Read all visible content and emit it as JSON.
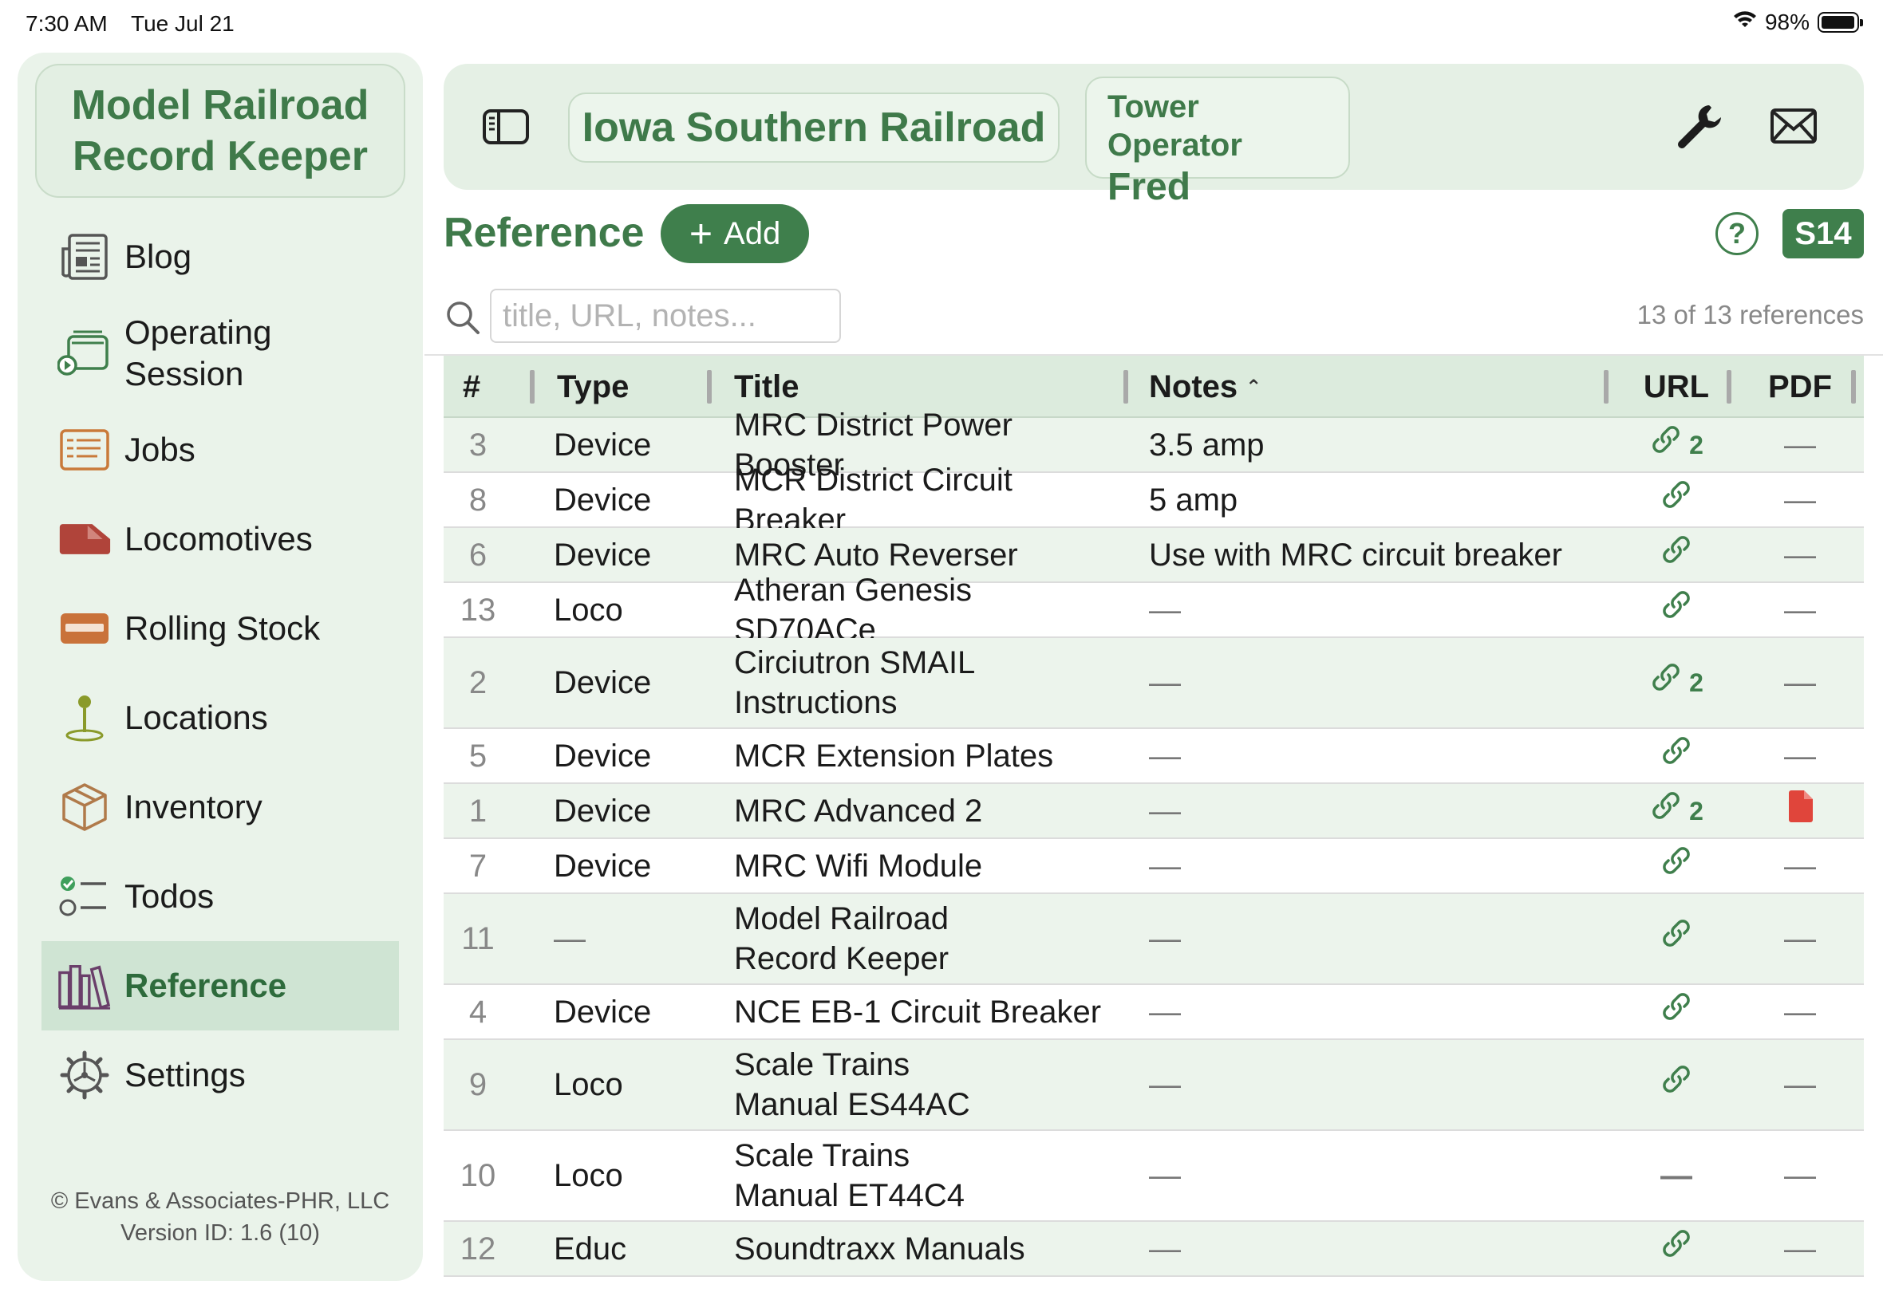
{
  "status_bar": {
    "time": "7:30 AM",
    "date": "Tue Jul 21",
    "battery": "98%",
    "battery_level": 0.98
  },
  "sidebar": {
    "app_title": "Model Railroad\nRecord Keeper",
    "items": [
      {
        "label": "Blog",
        "icon": "newspaper-icon"
      },
      {
        "label": "Operating\nSession",
        "icon": "operating-session-icon"
      },
      {
        "label": "Jobs",
        "icon": "jobs-list-icon"
      },
      {
        "label": "Locomotives",
        "icon": "locomotive-icon"
      },
      {
        "label": "Rolling Stock",
        "icon": "rolling-stock-icon"
      },
      {
        "label": "Locations",
        "icon": "location-pin-icon"
      },
      {
        "label": "Inventory",
        "icon": "box-icon"
      },
      {
        "label": "Todos",
        "icon": "checklist-icon"
      },
      {
        "label": "Reference",
        "icon": "books-icon",
        "active": true
      },
      {
        "label": "Settings",
        "icon": "gear-icon"
      }
    ],
    "copyright": "© Evans & Associates-PHR, LLC",
    "version": "Version ID: 1.6 (10)"
  },
  "header": {
    "railroad": "Iowa Southern Railroad",
    "operator_role": "Tower Operator",
    "operator_name": "Fred"
  },
  "page": {
    "title": "Reference",
    "add_label": "Add",
    "help_label": "?",
    "badge": "S14",
    "search_placeholder": "title, URL, notes...",
    "count_text": "13 of 13 references"
  },
  "table": {
    "columns": {
      "num": "#",
      "type": "Type",
      "title": "Title",
      "notes": "Notes",
      "url": "URL",
      "pdf": "PDF"
    },
    "sort": {
      "column": "Notes",
      "direction": "ascending"
    },
    "rows": [
      {
        "num": "3",
        "type": "Device",
        "title": "MRC District Power Booster",
        "notes": "3.5 amp",
        "url": "link",
        "url_count": "2",
        "pdf": "—"
      },
      {
        "num": "8",
        "type": "Device",
        "title": "MCR District Circuit Breaker",
        "notes": "5 amp",
        "url": "link",
        "url_count": "",
        "pdf": "—"
      },
      {
        "num": "6",
        "type": "Device",
        "title": "MRC Auto Reverser",
        "notes": "Use with MRC circuit breaker",
        "url": "link",
        "url_count": "",
        "pdf": "—"
      },
      {
        "num": "13",
        "type": "Loco",
        "title": "Atheran Genesis SD70ACe",
        "notes": "—",
        "url": "link",
        "url_count": "",
        "pdf": "—"
      },
      {
        "num": "2",
        "type": "Device",
        "title": "Circiutron SMAIL\nInstructions",
        "notes": "—",
        "url": "link",
        "url_count": "2",
        "pdf": "—"
      },
      {
        "num": "5",
        "type": "Device",
        "title": "MCR Extension Plates",
        "notes": "—",
        "url": "link",
        "url_count": "",
        "pdf": "—"
      },
      {
        "num": "1",
        "type": "Device",
        "title": "MRC Advanced 2",
        "notes": "—",
        "url": "link",
        "url_count": "2",
        "pdf": "file"
      },
      {
        "num": "7",
        "type": "Device",
        "title": "MRC Wifi Module",
        "notes": "—",
        "url": "link",
        "url_count": "",
        "pdf": "—"
      },
      {
        "num": "11",
        "type": "—",
        "title": "Model Railroad\nRecord Keeper",
        "notes": "—",
        "url": "link",
        "url_count": "",
        "pdf": "—"
      },
      {
        "num": "4",
        "type": "Device",
        "title": "NCE EB-1 Circuit Breaker",
        "notes": "—",
        "url": "link",
        "url_count": "",
        "pdf": "—"
      },
      {
        "num": "9",
        "type": "Loco",
        "title": "Scale Trains\nManual ES44AC",
        "notes": "—",
        "url": "link",
        "url_count": "",
        "pdf": "—"
      },
      {
        "num": "10",
        "type": "Loco",
        "title": "Scale Trains\nManual ET44C4",
        "notes": "—",
        "url": "—",
        "url_count": "",
        "pdf": "—"
      },
      {
        "num": "12",
        "type": "Educ",
        "title": "Soundtraxx Manuals",
        "notes": "—",
        "url": "link",
        "url_count": "",
        "pdf": "—"
      }
    ]
  },
  "colors": {
    "accent": "#3f7f4c",
    "sidebar_bg": "#eaf3ea",
    "row_alt": "#ecf4ec",
    "pdf_red": "#e0453b"
  }
}
